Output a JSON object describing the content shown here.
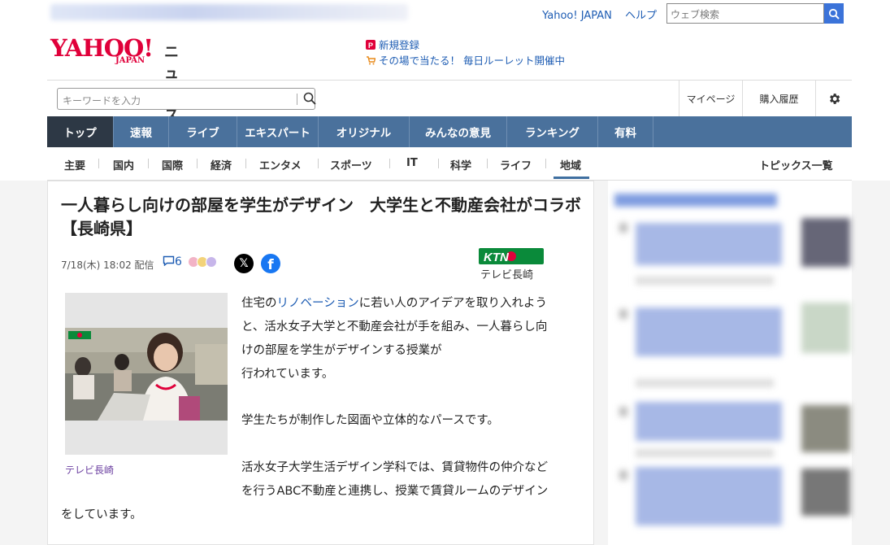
{
  "header": {
    "top_links": [
      "Yahoo! JAPAN",
      "ヘルプ"
    ],
    "web_search_placeholder": "ウェブ検索",
    "logo_text": "YAHOO!",
    "logo_sub": "JAPAN",
    "logo_news": "ニュース",
    "promo_signup": "新規登録",
    "promo_roulette": "その場で当たる！ 毎日ルーレット開催中",
    "keyword_placeholder": "キーワードを入力",
    "right_links": [
      "マイページ",
      "購入履歴"
    ]
  },
  "nav": [
    "トップ",
    "速報",
    "ライブ",
    "エキスパート",
    "オリジナル",
    "みんなの意見",
    "ランキング",
    "有料"
  ],
  "subnav": [
    "主要",
    "国内",
    "国際",
    "経済",
    "エンタメ",
    "スポーツ",
    "IT",
    "科学",
    "ライフ",
    "地域"
  ],
  "subnav_right": "トピックス一覧",
  "article": {
    "title": "一人暮らし向けの部屋を学生がデザイン　大学生と不動産会社がコラボ【長崎県】",
    "date": "7/18(木) 18:02 配信",
    "comment_count": "6",
    "source_name": "テレビ長崎",
    "source_logo_text": "KTN",
    "photo_caption": "テレビ長崎",
    "p1_prefix": "住宅の",
    "p1_link": "リノベーション",
    "p1_line1_rest": "に若い人のアイデアを取り入れよう",
    "p1_line2": "と、活水女子大学と不動産会社が手を組み、一人暮らし向",
    "p1_line3": "けの部屋を学生がデザインする授業が",
    "p1_line4": "行われています。",
    "p2": "学生たちが制作した図面や立体的なパースです。",
    "p3_line1": "活水女子大学生活デザイン学科では、賃貸物件の仲介など",
    "p3_line2": "を行うABC不動産と連携し、授業で賃貸ルームのデザイン",
    "p3_line3": "をしています。"
  }
}
